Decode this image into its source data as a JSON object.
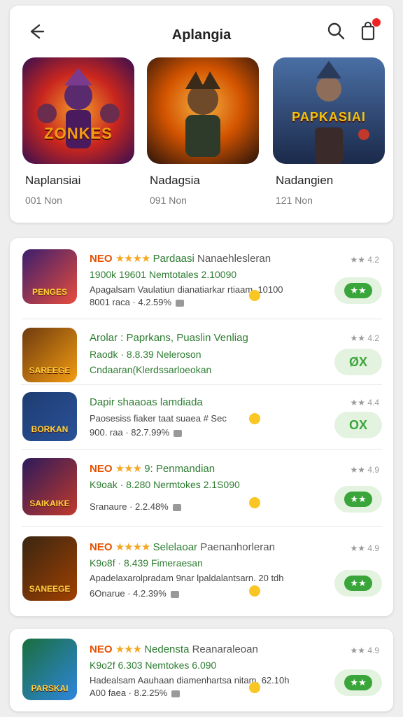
{
  "header": {
    "title": "Aplangia"
  },
  "featured": [
    {
      "art_label": "ZONKES",
      "name": "Naplansiai",
      "sub": "001 Non",
      "colors": [
        "#3a0f4f",
        "#c9261e",
        "#f39c2a"
      ]
    },
    {
      "art_label": "",
      "name": "Nadagsia",
      "sub": "091 Non",
      "colors": [
        "#3a1a0a",
        "#d35400",
        "#f5b041"
      ]
    },
    {
      "art_label": "PAPKASIAI",
      "name": "Nadangien",
      "sub": "121 Non",
      "colors": [
        "#1b2a4a",
        "#4a6fa5",
        "#c0392b"
      ]
    }
  ],
  "list": [
    {
      "thumb_label": "PENGES",
      "tag": "NEO",
      "stars": "★★★★",
      "line1_rest": " Pardaasi",
      "line1_tail": " Nanaehlesleran",
      "line2": "1900k 19601 Nemtotales 2.10090",
      "line3": "Apagalsam Vaulatiun dianatiarkar rtiaam. 10100",
      "line4": "8001 raca · 4.2.59%",
      "rating": "★★ 4.2",
      "action": "★★",
      "action_style": "pill",
      "colors": [
        "#3b1e6e",
        "#e74c3c"
      ]
    },
    {
      "thumb_label": "SAREEGE",
      "tag": "",
      "stars": "",
      "line1_rest": "Arolar : Paprkans, Puaslin Venliag",
      "line1_tail": "",
      "line2": "Raodk · 8.8.39 Neleroson",
      "line3": "Cndaaran(Klerdssarloeokan",
      "line4": "",
      "rating": "★★ 4.2",
      "action": "ØX",
      "action_style": "text",
      "colors": [
        "#6e3b0f",
        "#f39c12"
      ]
    },
    {
      "thumb_label": "BORKAN",
      "tag": "",
      "stars": "",
      "line1_rest": "Dapir shaaoas lamdiada",
      "line1_tail": "",
      "line2": "Paosesiss fiaker taat suaea # Sec",
      "line3": "900. raa · 82.7.99%",
      "line4": "",
      "rating": "★★ 4.4",
      "action": "OX",
      "action_style": "text",
      "colors": [
        "#1e3c72",
        "#2a5298"
      ]
    },
    {
      "thumb_label": "SAIKAIKE",
      "tag": "NEO",
      "stars": "★★★",
      "line1_rest": " 9: Penmandian",
      "line1_tail": "",
      "line2": "K9oak · 8.280 Nermtokes 2.1S090",
      "line3": "",
      "line4": "Sranaure · 2.2.48%",
      "rating": "★★ 4.9",
      "action": "★★",
      "action_style": "pill",
      "colors": [
        "#2c1a5c",
        "#c0392b"
      ]
    },
    {
      "thumb_label": "SANEEGE",
      "tag": "NEO",
      "stars": "★★★★",
      "line1_rest": " Selelaoar",
      "line1_tail": " Paenanhorleran",
      "line2": "K9o8f · 8.439 Fimeraesan",
      "line3": "Apadelaxarolpradam 9nar lpaldalantsarn. 20 tdh",
      "line4": "6Onarue · 4.2.39%",
      "rating": "★★ 4.9",
      "action": "★★",
      "action_style": "pill",
      "colors": [
        "#3a2612",
        "#a04000"
      ]
    }
  ],
  "list2": [
    {
      "thumb_label": "PARSKAI",
      "tag": "NEO",
      "stars": "★★★",
      "line1_rest": " Nedensta",
      "line1_tail": " Reanaraleoan",
      "line2": "K9o2f 6.303 Nemtokes 6.090",
      "line3": "Hadealsam Aauhaan diamenhartsa nitam. 62.10h",
      "line4": "A00 faea · 8.2.25%",
      "rating": "★★ 4.9",
      "action": "★★",
      "action_style": "pill",
      "colors": [
        "#1a6e3c",
        "#2e86de"
      ]
    }
  ]
}
